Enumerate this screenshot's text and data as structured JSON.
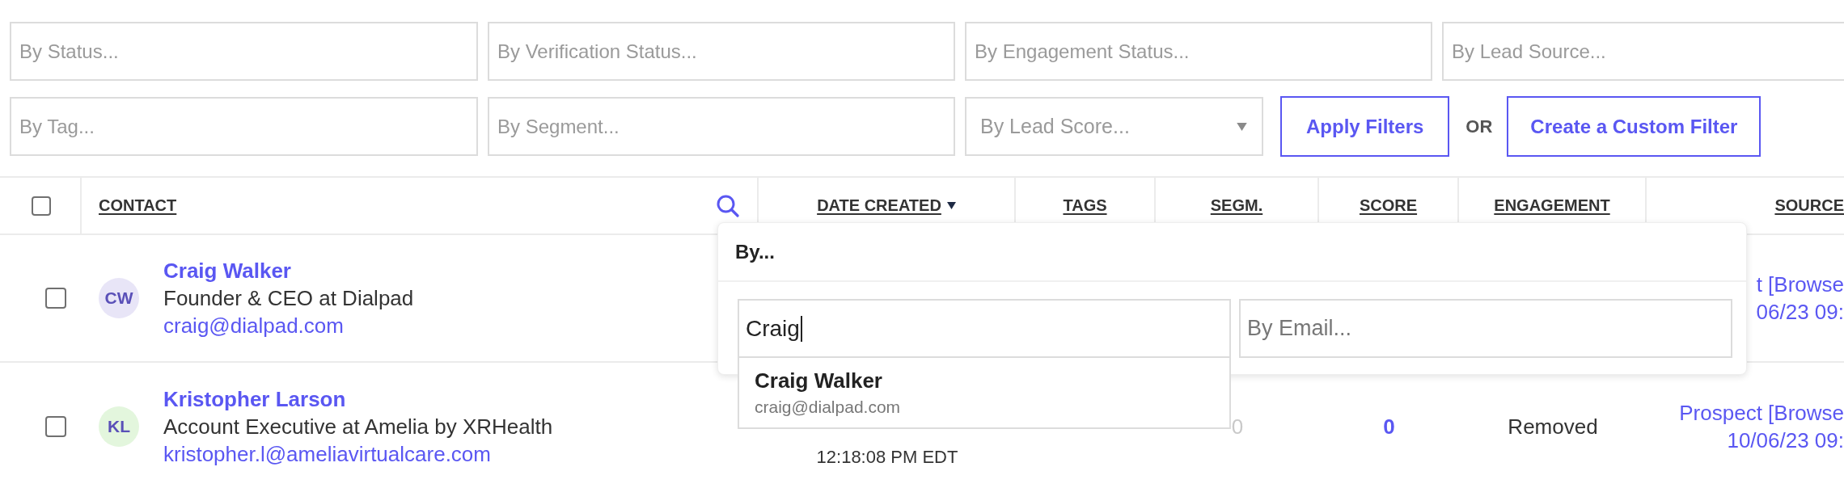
{
  "filters": {
    "rows": [
      [
        {
          "kind": "text",
          "placeholder": "By Status..."
        },
        {
          "kind": "text",
          "placeholder": "By Verification Status..."
        },
        {
          "kind": "text",
          "placeholder": "By Engagement Status..."
        },
        {
          "kind": "text",
          "placeholder": "By Lead Source..."
        }
      ],
      [
        {
          "kind": "text",
          "placeholder": "By Tag..."
        },
        {
          "kind": "text",
          "placeholder": "By Segment..."
        },
        {
          "kind": "select",
          "placeholder": "By Lead Score..."
        }
      ]
    ],
    "apply_button": "Apply Filters",
    "separator": "OR",
    "custom_filter_button": "Create a Custom Filter"
  },
  "table": {
    "select_all": {
      "checked": false
    },
    "columns": [
      {
        "label": "CONTACT",
        "sorted": false,
        "searchable": true
      },
      {
        "label": "DATE CREATED",
        "sorted": true,
        "searchable": false
      },
      {
        "label": "TAGS",
        "sorted": false,
        "searchable": false
      },
      {
        "label": "SEGM.",
        "sorted": false,
        "searchable": false
      },
      {
        "label": "SCORE",
        "sorted": false,
        "searchable": false
      },
      {
        "label": "ENGAGEMENT",
        "sorted": false,
        "searchable": false
      },
      {
        "label": "SOURCE",
        "sorted": false,
        "searchable": false
      }
    ],
    "rows": [
      {
        "checked": false,
        "avatar": {
          "initials": "CW",
          "color": "#e8e5f7"
        },
        "name": "Craig Walker",
        "title": "Founder & CEO at Dialpad",
        "email": "craig@dialpad.com",
        "source": [
          "t [Browse",
          "06/23 09:"
        ]
      },
      {
        "checked": false,
        "avatar": {
          "initials": "KL",
          "color": "#e3f6dd"
        },
        "name": "Kristopher Larson",
        "title": "Account Executive at Amelia by XRHealth",
        "email": "kristopher.l@ameliavirtualcare.com",
        "date_created": "12:18:08 PM EDT",
        "segments": "0",
        "score": "0",
        "engagement": "Removed",
        "source": [
          "Prospect [Browse",
          "10/06/23 09:"
        ]
      }
    ]
  },
  "search_popup": {
    "title": "By...",
    "name_field": {
      "value": "Craig",
      "focused": true
    },
    "email_field": {
      "placeholder": "By Email..."
    },
    "suggestions": [
      {
        "name": "Craig Walker",
        "email": "craig@dialpad.com"
      }
    ]
  }
}
